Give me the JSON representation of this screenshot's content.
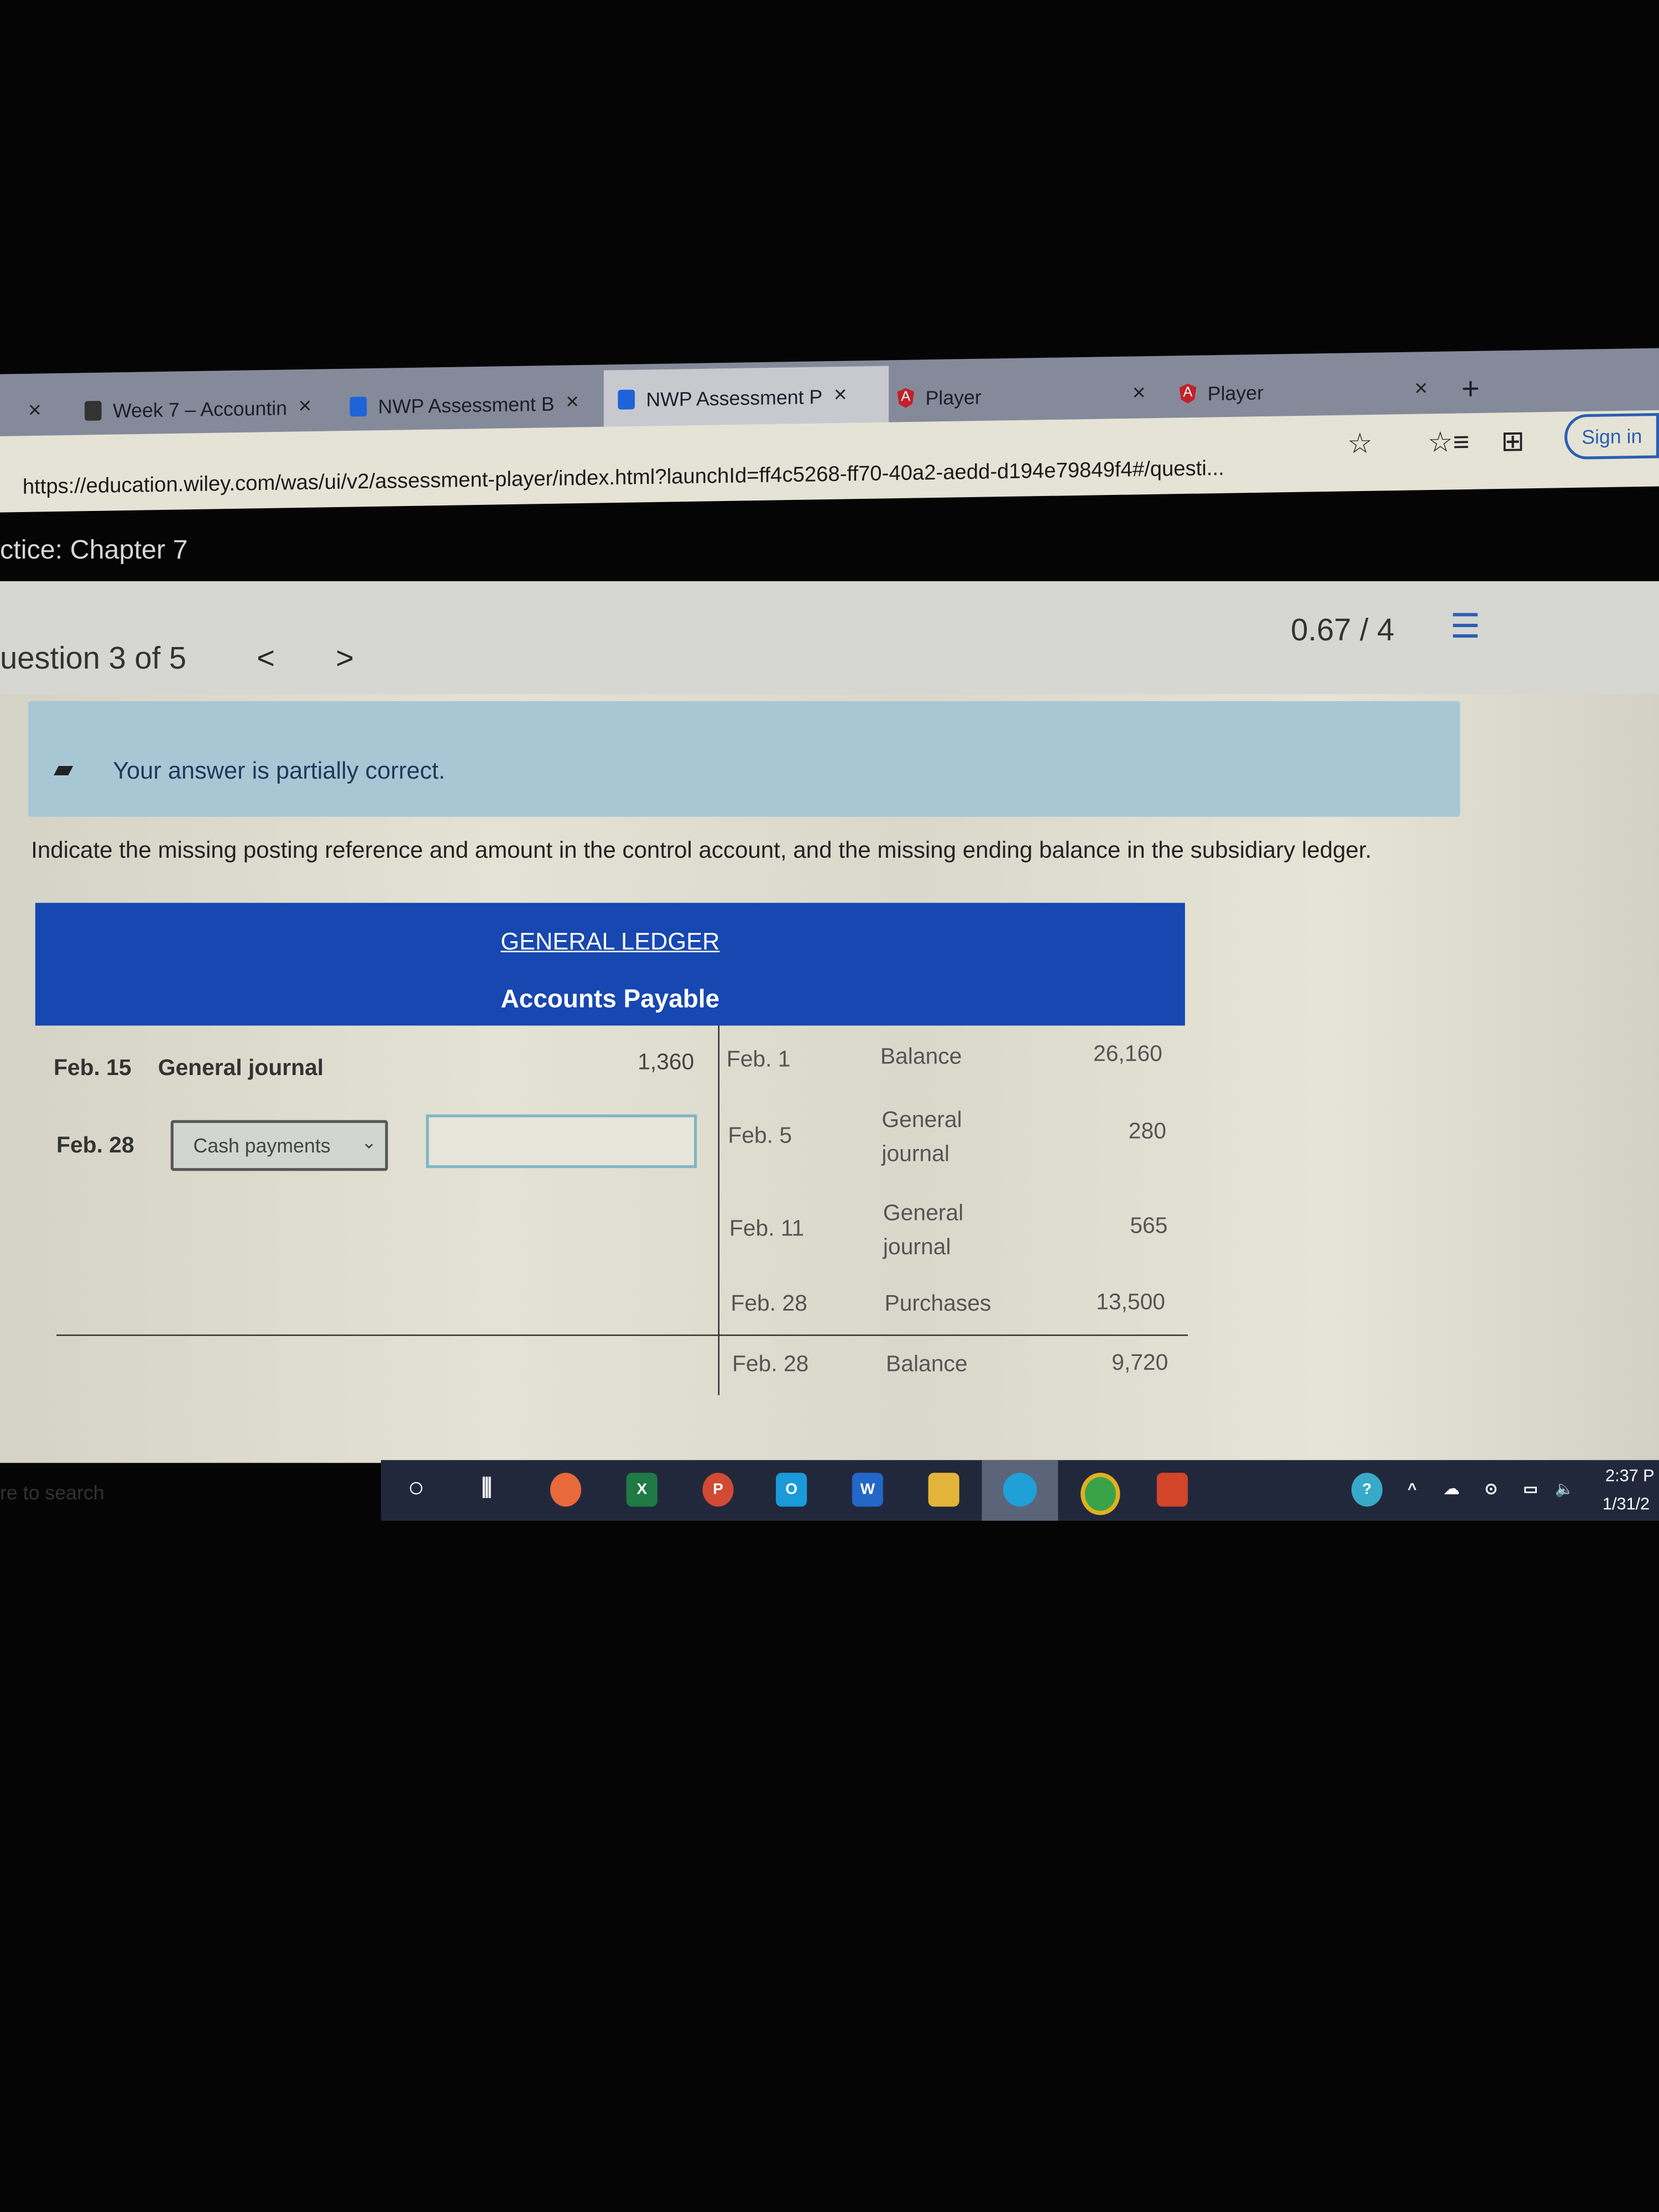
{
  "browser": {
    "tabs": [
      {
        "label": "Week 7 – Accountin",
        "icon": "wiley-icon"
      },
      {
        "label": "NWP Assessment B",
        "icon": "wp-icon"
      },
      {
        "label": "NWP Assessment P",
        "icon": "wp-icon",
        "active": true
      },
      {
        "label": "Player",
        "icon": "angular-icon"
      },
      {
        "label": "Player",
        "icon": "angular-icon"
      }
    ],
    "close_glyph": "×",
    "new_tab": "+",
    "url": "https://education.wiley.com/was/ui/v2/assessment-player/index.html?launchId=ff4c5268-ff70-40a2-aedd-d194e79849f4#/questi...",
    "sign_in": "Sign in"
  },
  "page": {
    "course_title": "ctice: Chapter 7",
    "question_label": "uestion 3 of 5",
    "prev": "<",
    "next": ">",
    "score": "0.67 / 4",
    "feedback": "Your answer is partially correct.",
    "instruction": "Indicate the missing posting reference and amount in the control account, and the missing ending balance in the subsidiary ledger.",
    "colors": {
      "header_blue": "#1747b0",
      "feedback_bg": "#a8c7d4"
    }
  },
  "ledger": {
    "title": "GENERAL LEDGER",
    "account": "Accounts Payable",
    "debits": [
      {
        "date": "Feb. 15",
        "ref": "General journal",
        "amount": "1,360"
      },
      {
        "date": "Feb. 28",
        "ref_select": "Cash payments",
        "amount_input": ""
      }
    ],
    "credits": [
      {
        "date": "Feb. 1",
        "ref": "Balance",
        "amount": "26,160"
      },
      {
        "date": "Feb. 5",
        "ref": "General journal",
        "amount": "280"
      },
      {
        "date": "Feb. 11",
        "ref": "General journal",
        "amount": "565"
      },
      {
        "date": "Feb. 28",
        "ref": "Purchases",
        "amount": "13,500"
      }
    ],
    "ending": {
      "date": "Feb. 28",
      "ref": "Balance",
      "amount": "9,720"
    }
  },
  "taskbar": {
    "search": "re to search",
    "time": "2:37 P",
    "date": "1/31/2"
  }
}
